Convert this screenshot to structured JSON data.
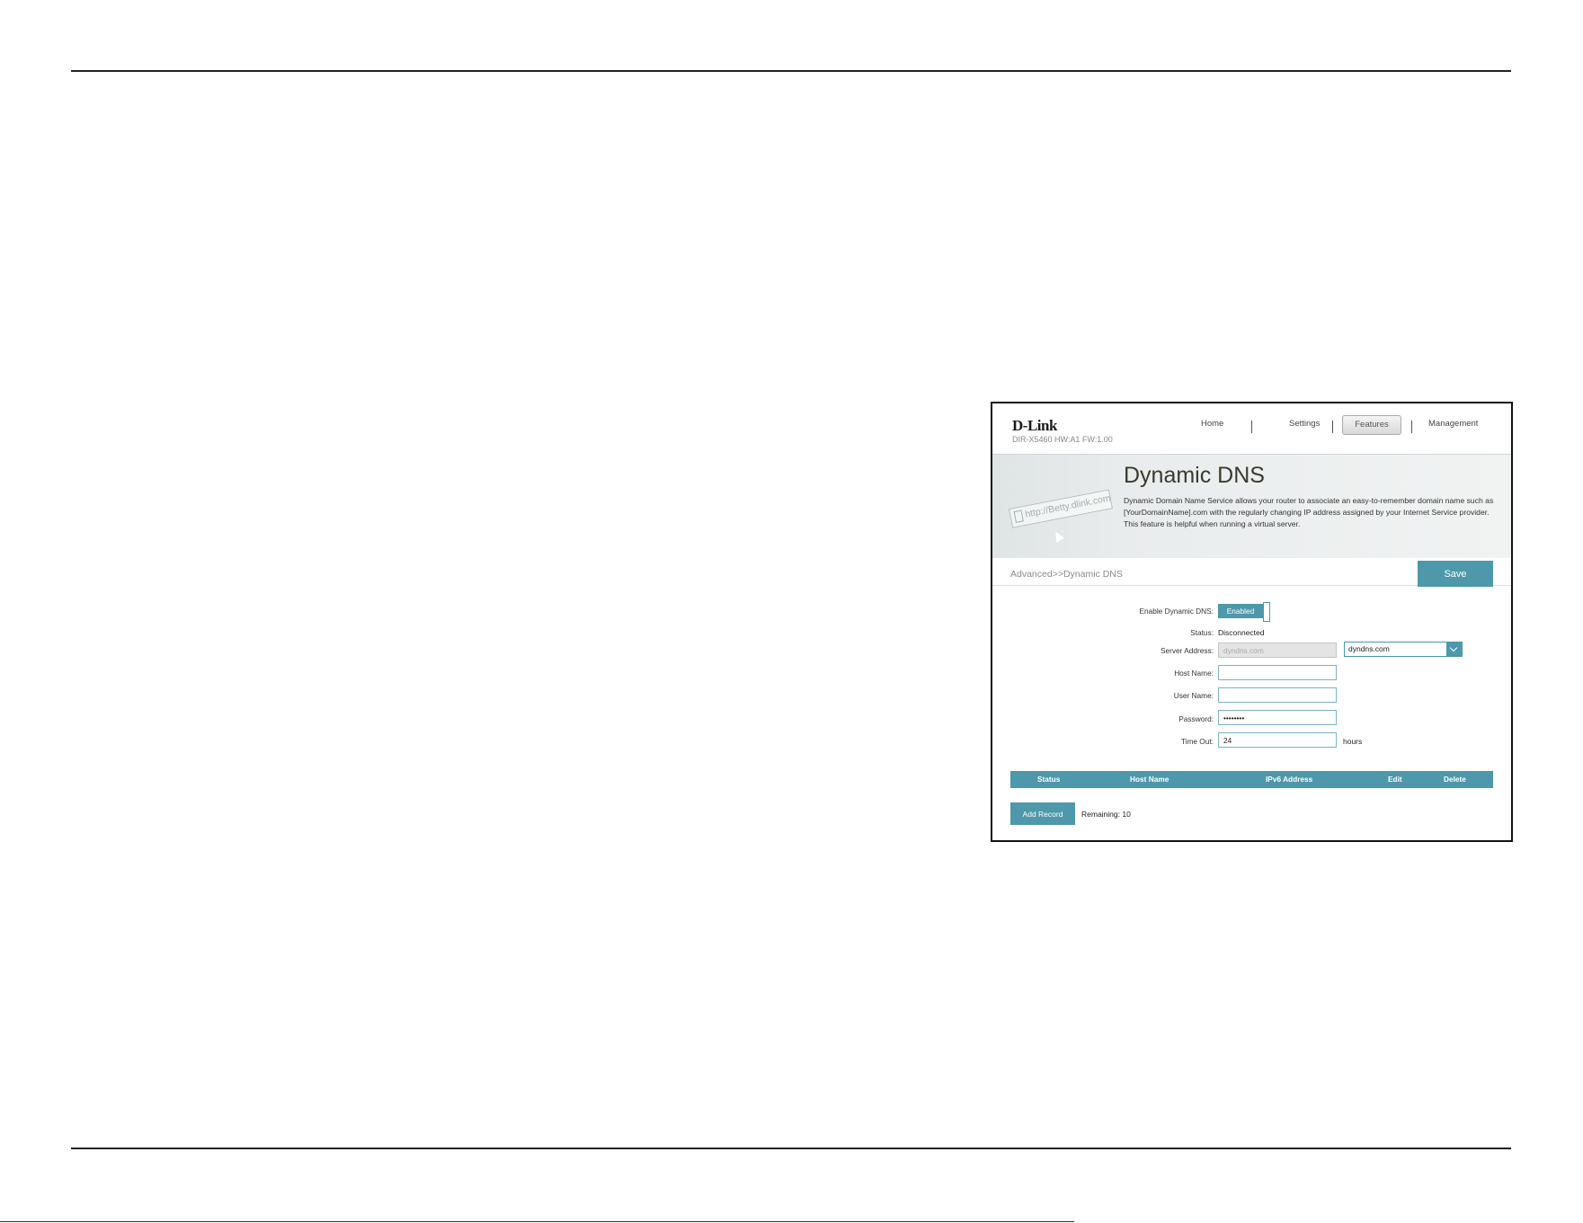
{
  "router": {
    "brand": "D-Link",
    "model": "DIR-X5460 HW:A1 FW:1.00",
    "nav": {
      "home": "Home",
      "settings": "Settings",
      "features": "Features",
      "management": "Management"
    },
    "banner": {
      "title": "Dynamic DNS",
      "description": "Dynamic Domain Name Service allows your router to associate an easy-to-remember domain name such as [YourDomainName].com with the regularly changing IP address assigned by your Internet Service provider. This feature is helpful when running a virtual server.",
      "illustration_url": "http://Betty.dlink.com"
    },
    "breadcrumb": "Advanced>>Dynamic DNS",
    "save_label": "Save",
    "form": {
      "enable_label": "Enable Dynamic DNS:",
      "enable_value": "Enabled",
      "status_label": "Status:",
      "status_value": "Disconnected",
      "server_label": "Server Address:",
      "server_value": "dyndns.com",
      "server_select": "dyndns.com",
      "host_label": "Host Name:",
      "host_value": "",
      "user_label": "User Name:",
      "user_value": "",
      "password_label": "Password:",
      "password_value": "••••••••",
      "timeout_label": "Time Out:",
      "timeout_value": "24",
      "timeout_unit": "hours"
    },
    "table": {
      "columns": [
        "Status",
        "Host Name",
        "IPv6 Address",
        "Edit",
        "Delete"
      ]
    },
    "add_record_label": "Add Record",
    "remaining": "Remaining: 10"
  },
  "colors": {
    "accent": "#4d98aa"
  }
}
